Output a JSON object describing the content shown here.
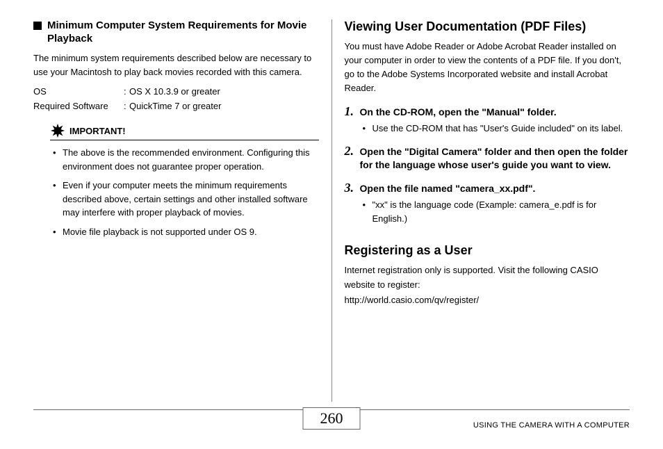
{
  "left": {
    "section_title": "Minimum Computer System Requirements for Movie Playback",
    "intro": "The minimum system requirements described below are necessary to use your Macintosh to play back movies recorded with this camera.",
    "specs": [
      {
        "label": "OS",
        "value": "OS X 10.3.9 or greater"
      },
      {
        "label": "Required Software",
        "value": "QuickTime 7 or greater"
      }
    ],
    "important_label": "IMPORTANT!",
    "important_items": [
      "The above is the recommended environment. Configuring this environment does not guarantee proper operation.",
      "Even if your computer meets the minimum requirements described above, certain settings and other installed software may interfere with proper playback of movies.",
      "Movie file playback is not supported under OS 9."
    ]
  },
  "right": {
    "h2_viewing": "Viewing User Documentation (PDF Files)",
    "viewing_para": "You must have Adobe Reader or Adobe Acrobat Reader installed on your computer in order to view the contents of a PDF file. If you don't, go to the Adobe Systems Incorporated website and install Acrobat Reader.",
    "steps": [
      {
        "num": "1.",
        "text": "On the CD-ROM, open the \"Manual\" folder.",
        "bullets": [
          "Use the CD-ROM that has \"User's Guide included\" on its label."
        ]
      },
      {
        "num": "2.",
        "text": "Open the \"Digital Camera\" folder and then open the folder for the language whose user's guide you want to view.",
        "bullets": []
      },
      {
        "num": "3.",
        "text": "Open the file named \"camera_xx.pdf\".",
        "bullets": [
          "\"xx\" is the language code (Example: camera_e.pdf is for English.)"
        ]
      }
    ],
    "h2_register": "Registering as a User",
    "register_para": "Internet registration only is supported. Visit the following CASIO website to register:",
    "register_url": "http://world.casio.com/qv/register/"
  },
  "footer": {
    "page": "260",
    "label": "USING THE CAMERA WITH A COMPUTER"
  }
}
